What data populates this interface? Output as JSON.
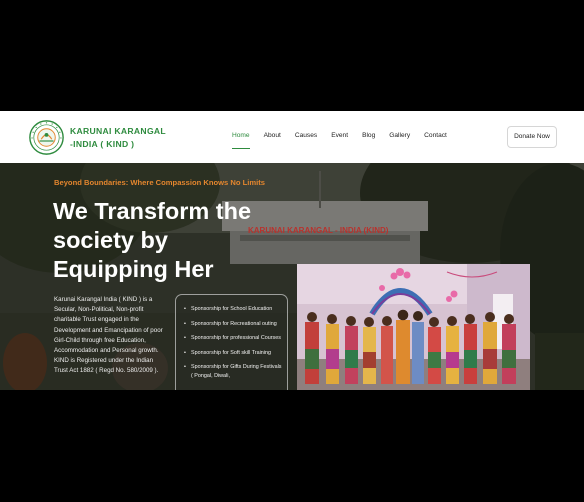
{
  "brand": {
    "line1": "KARUNAI KARANGAL",
    "line2": "-INDIA ( KIND )",
    "logo_icon": "kind-seal-logo"
  },
  "nav": {
    "items": [
      {
        "label": "Home",
        "active": true
      },
      {
        "label": "About"
      },
      {
        "label": "Causes"
      },
      {
        "label": "Event"
      },
      {
        "label": "Blog"
      },
      {
        "label": "Gallery"
      },
      {
        "label": "Contact"
      }
    ]
  },
  "cta": {
    "donate_label": "Donate Now"
  },
  "hero": {
    "tagline": "Beyond Boundaries: Where Compassion Knows No Limits",
    "title": "We Transform the society by Equipping Her",
    "about": "Karunai Karangal India ( KIND ) is a Secular, Non-Political, Non-profit charitable Trust engaged in the Development and Emancipation of poor Girl-Child through free Education, Accommodation and Personal growth. KIND is Registered under the Indian Trust Act 1882 ( Regd No. 580/2009 ).",
    "building_sign": "KARUNAI KARANGAL - INDIA (KIND)",
    "services": [
      "Sponsorship for School Education",
      "Sponsorship for Recreational outing",
      "Sponsorship for professional Courses",
      "Sponsorship for Soft skill Training",
      "Sponsorship for Gifts During Festivals ( Pongal, Diwali,"
    ]
  },
  "colors": {
    "accent_green": "#2e8b3e",
    "accent_orange": "#e4862e"
  }
}
